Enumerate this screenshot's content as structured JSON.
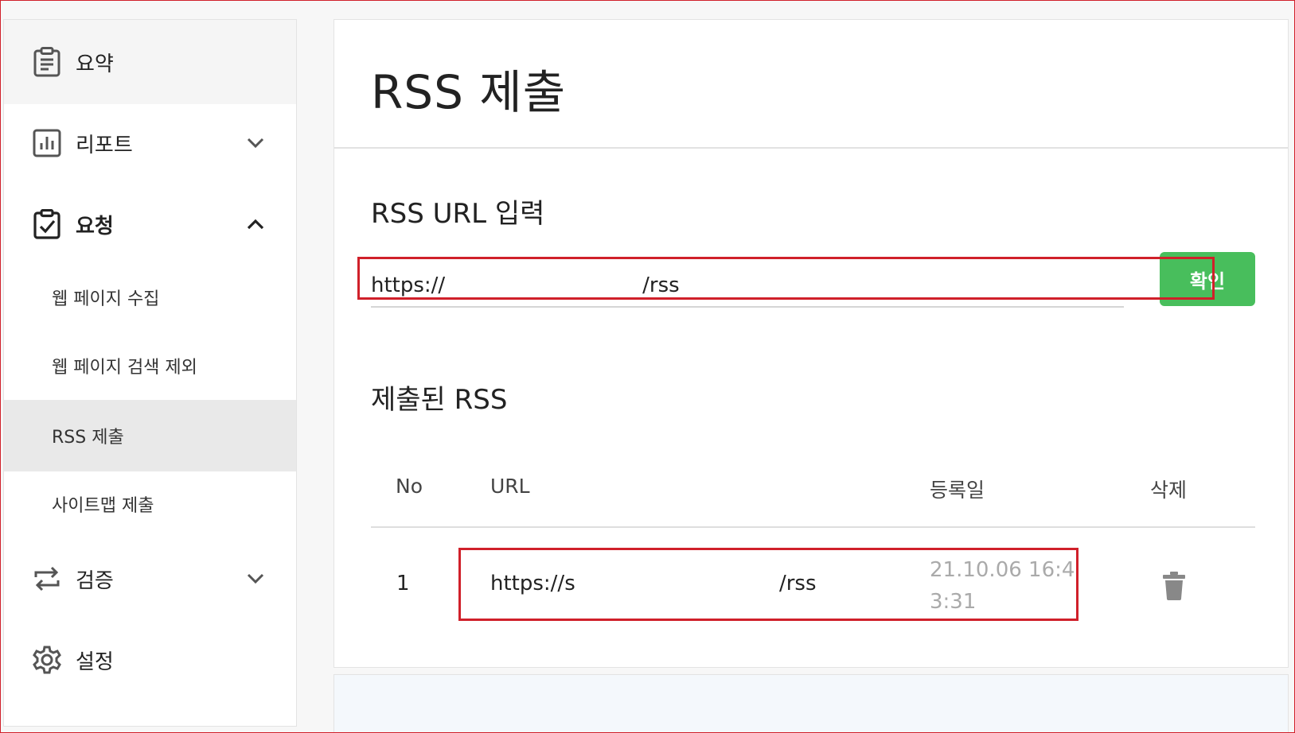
{
  "sidebar": {
    "items": [
      {
        "label": "요약",
        "icon": "clipboard-list-icon"
      },
      {
        "label": "리포트",
        "icon": "bar-chart-icon"
      },
      {
        "label": "요청",
        "icon": "clipboard-check-icon"
      },
      {
        "label": "검증",
        "icon": "repeat-arrows-icon"
      },
      {
        "label": "설정",
        "icon": "gear-icon"
      }
    ],
    "sub_items": [
      {
        "label": "웹 페이지 수집"
      },
      {
        "label": "웹 페이지 검색 제외"
      },
      {
        "label": "RSS 제출"
      },
      {
        "label": "사이트맵 제출"
      }
    ]
  },
  "main": {
    "title": "RSS 제출",
    "input_section_title": "RSS URL 입력",
    "input_value": "https://                              /rss",
    "confirm_label": "확인",
    "submitted_title": "제출된 RSS",
    "table": {
      "headers": [
        "No",
        "URL",
        "등록일",
        "삭제"
      ],
      "rows": [
        {
          "no": "1",
          "url": "https://s                               /rss",
          "date": "21.10.06 16:43:31"
        }
      ]
    }
  },
  "colors": {
    "accent_green": "#48be5c",
    "highlight_red": "#d0202a",
    "active_sub_bg": "#e9e9e9"
  }
}
